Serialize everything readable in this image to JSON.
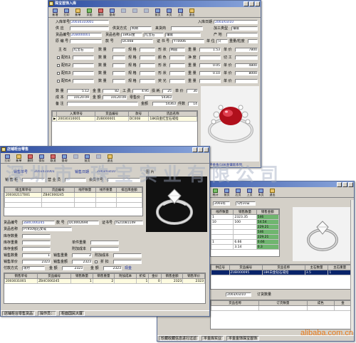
{
  "window_purchase": {
    "title": "珠宝首饰入库",
    "toolbar": [
      "新增",
      "打印",
      "新单",
      "添加",
      "删除",
      "查询",
      "",
      "",
      "",
      "",
      "",
      "前页",
      "末页",
      "上页",
      "退出"
    ],
    "labels": {
      "doc_no": "入库单号",
      "date": "入库日期",
      "supplier": "供 应",
      "pay_method": "供货方式",
      "sale_mode": "来货商",
      "category_type": "加工类型",
      "goods_no": "货品编号",
      "goods_name": "货品名称",
      "origin": "产 地",
      "vendor_code": "原 编 号",
      "style_no": "款 号",
      "cert_no": "证 书 号",
      "unit": "单 位",
      "weight": "重量/粒度",
      "main_stone": "主 石",
      "material": "数 量",
      "spec": "规 格",
      "shape": "形 状",
      "color": "颜 色",
      "clarity": "净 度",
      "cut": "切 工",
      "fluor": "荧 光",
      "weight2": "重 量",
      "price": "单 价",
      "side1": "配石1",
      "side2": "配石2",
      "side3": "配石3",
      "side4": "配石4",
      "side5": "配石5",
      "qty": "数 量",
      "gold_wt": "金 重",
      "labor": "工 费",
      "loss": "损 耗",
      "unit_price": "单 价",
      "total": "成 本",
      "retail": "零 售 价",
      "barcode": "零售价",
      "amount": "金 额",
      "note": "备 注",
      "amount2": "金额",
      "pieces": "件数"
    },
    "values": {
      "doc_no": "20030310001",
      "date": "2003/03/10",
      "supplier": "",
      "pay_method": "购销",
      "sale_mode": "",
      "category_type": "镶嵌",
      "goods_no": "ZUB000001",
      "goods_name": "18K白金",
      "origin": "红宝石",
      "vendor_code": "",
      "style_no": "DC008",
      "cert_no": "YT0006",
      "unit": "只",
      "weight": "",
      "main_stone": "红宝石",
      "shape": "椭圆",
      "color": "红",
      "clarity": "",
      "weight2": "1.53",
      "price": "7800",
      "side_weights": [
        "0.05",
        "0.10",
        "",
        ""
      ],
      "side_prices": [
        "4800",
        "8000",
        "",
        ""
      ],
      "qty": "5.12",
      "gold_wt": "82",
      "labor": "4.95",
      "loss": "25",
      "unit_price": "30",
      "total": "10120.09",
      "retail": "54363",
      "amount": "10120.09",
      "amount2": "54363",
      "mark": "14"
    },
    "grid": {
      "headers": [
        "入库单号",
        "货品编号",
        "款号",
        "货品名称",
        "",
        ""
      ],
      "rows": [
        [
          "20030310001",
          "ZUB000001",
          "DC008",
          "18K白金红宝石戒指",
          "",
          ""
        ]
      ]
    },
    "photo_caption": "平金金/18K金镶嵌系列"
  },
  "window_retail": {
    "title": "店铺柜台零售",
    "toolbar": [
      "打印",
      "新单",
      "删除",
      "保存",
      "取消",
      "查询",
      "",
      "前页",
      "",
      "退出"
    ],
    "labels": {
      "doc_no": "销售单号",
      "date": "销售日期",
      "photo": "图 片",
      "store": "销 售 柜",
      "salesman": "营 业 员",
      "customer": "会员卡号"
    },
    "values": {
      "doc_no": "2003031001",
      "date": "2003/03/10",
      "store": "",
      "salesman": "",
      "customer": ""
    },
    "top_grid": {
      "headers": [
        "排出库单号",
        "货品编号",
        "线存数量",
        "线存重量",
        "排出库金额"
      ],
      "rows": [
        [
          "20030211T001",
          "ZB4C000245",
          "",
          "",
          ""
        ],
        [
          "",
          "",
          "",
          "",
          ""
        ],
        [
          "",
          "",
          "",
          "",
          ""
        ]
      ]
    },
    "detail": {
      "goods_no_lbl": "货品编号",
      "goods_no": "ZB4C000245",
      "style_lbl": "款 号",
      "style": "DC0002694",
      "cert_lbl": "证书号",
      "cert": "IS21081149",
      "name_lbl": "货品名称",
      "name": "PT950钻石女戒",
      "stock_qty_lbl": "库存数量",
      "stock_wt_lbl": "库存重量",
      "stock_amt_lbl": "库存金额",
      "unit_price_lbl": "单件重量",
      "cost_lbl": "附加成本",
      "sell_qty_lbl": "销售数量",
      "sell_qty": "1",
      "sell_wt_lbl": "销售重量",
      "sell_wt": "2",
      "add_cost_lbl": "附加成本",
      "sell_price_lbl": "销售单价",
      "sell_price": "2323",
      "sell_amt_lbl": "销售金额",
      "sell_amt": "2323",
      "discount_lbl": "折 扣",
      "discount": "",
      "pay_lbl": "付款方式",
      "pay": "现付",
      "total_lbl": "金 额",
      "total": "2323",
      "cash_lbl": "金 额",
      "cash": "2323",
      "note": "现金"
    },
    "bottom_grid": {
      "headers": [
        "销售单号",
        "货品编号",
        "销售数量",
        "销售重量",
        "附加成本",
        "折扣",
        "金价",
        "销售金额",
        "销售单价"
      ],
      "rows": [
        [
          "2003031001",
          "ZB4C000245",
          "1",
          "2",
          "",
          "1",
          "0",
          "2323",
          "2323"
        ],
        [
          "",
          "",
          "",
          "",
          "",
          "",
          "",
          "",
          ""
        ]
      ]
    },
    "status": [
      "店铺柜台零售货品",
      "操作员：",
      "柜面国民大厦"
    ]
  },
  "window_sales": {
    "title": "",
    "toolbar": [
      "统计",
      "前页",
      "后页",
      "上页",
      "末页",
      "退出"
    ],
    "labels": {
      "doc_lbl": "销售单号",
      "date_lbl": "5月10日"
    },
    "values": {
      "date_from": "2003年",
      "date_to": "5月10日"
    },
    "grid": {
      "headers": [
        "线存数量",
        "销售数量",
        "销售金额"
      ],
      "rows": [
        [
          "",
          "1",
          "2323.35",
          "546"
        ],
        [
          "1",
          "10",
          "100",
          "54.54"
        ],
        [
          "",
          "",
          "",
          "229.21"
        ],
        [
          "",
          "",
          "",
          "546"
        ],
        [
          "",
          "",
          "",
          "229.21"
        ],
        [
          "",
          "1",
          "6.66",
          "0.66"
        ],
        [
          "",
          "",
          "3.14",
          "0.3"
        ],
        [
          "",
          "",
          "",
          ""
        ]
      ]
    },
    "lower_grid": {
      "headers": [
        "",
        "供应号",
        "货品编号",
        "货品名称",
        "",
        "主石数量",
        "主石重量"
      ],
      "rows": [
        [
          "",
          "",
          "ZUB000095",
          "18K白金钻石戒指",
          "",
          "3.5",
          "1",
          "0"
        ]
      ]
    },
    "lower_date": "2003/03/10",
    "lower_date_lbl": "订货数量",
    "third_grid": {
      "headers": [
        "货品名称",
        "",
        "订货数量",
        "",
        "成色",
        "金"
      ]
    },
    "status": [
      "平金库实业",
      "平金金饰珠宝首饰",
      ""
    ],
    "bottom_status": [
      "珍藏收藏信息进行过滤"
    ],
    "photo_caption": ""
  },
  "watermark": "深圳市 珠宝实业有限公司",
  "footer_brand": "alibaba.com.cn"
}
